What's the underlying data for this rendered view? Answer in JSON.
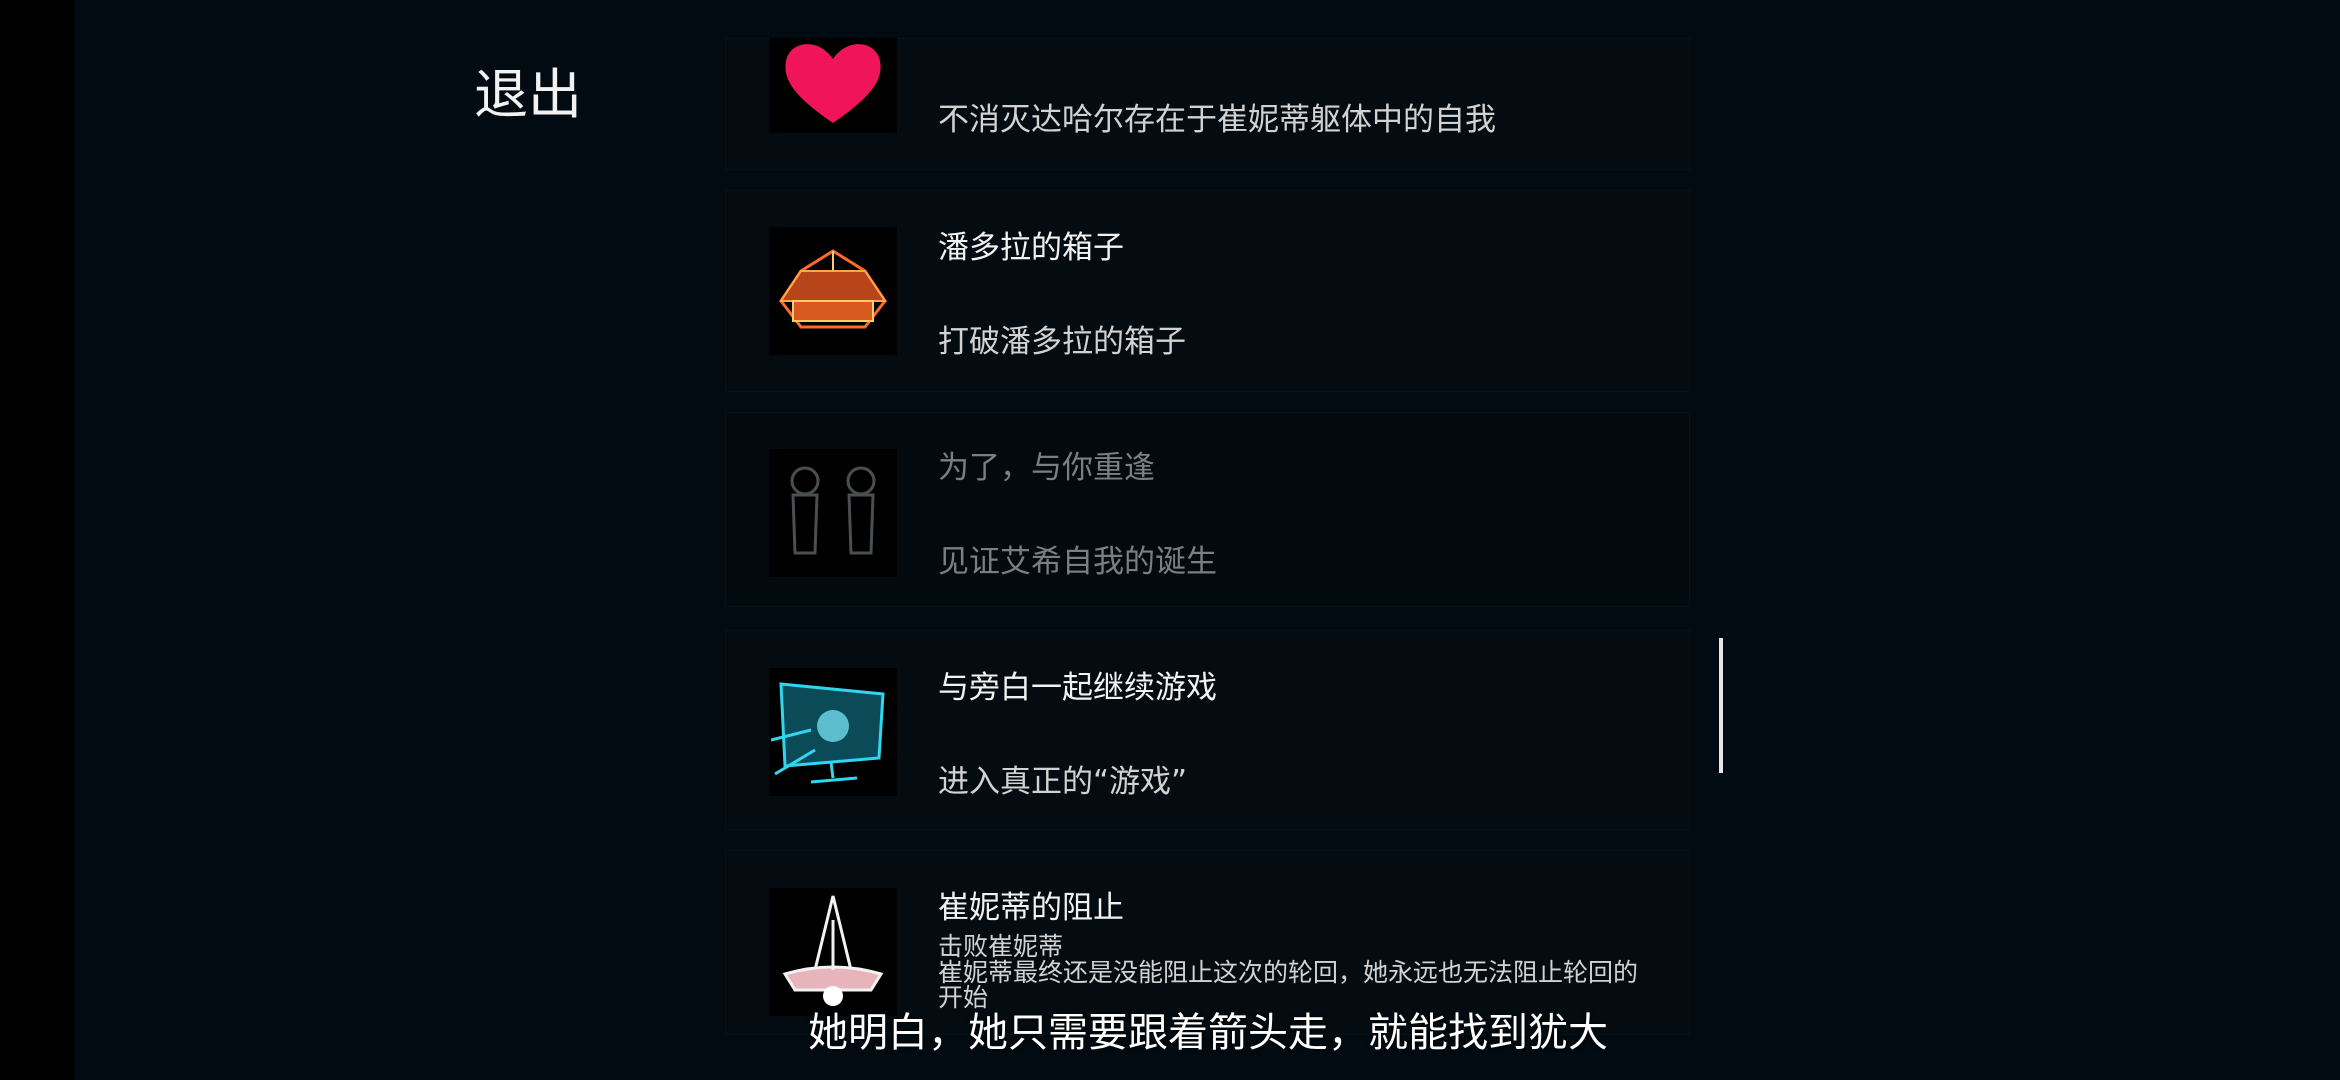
{
  "menu": {
    "exit_label": "退出"
  },
  "achievements": [
    {
      "title": "",
      "description": "不消灭达哈尔存在于崔妮蒂躯体中的自我",
      "icon": "heart-icon",
      "locked": false
    },
    {
      "title": "潘多拉的箱子",
      "description": "打破潘多拉的箱子",
      "icon": "pandora-box-icon",
      "locked": false
    },
    {
      "title": "为了，与你重逢",
      "description": "见证艾希自我的诞生",
      "icon": "twin-figures-icon",
      "locked": true
    },
    {
      "title": "与旁白一起继续游戏",
      "description": "进入真正的“游戏”",
      "icon": "monitor-icon",
      "locked": false
    },
    {
      "title": "崔妮蒂的阻止",
      "description": "击败崔妮蒂",
      "extra": "崔妮蒂最终还是没能阻止这次的轮回，她永远也无法阻止轮回的开始",
      "icon": "spire-icon",
      "locked": false
    }
  ],
  "subtitle": "她明白，她只需要跟着箭头走，就能找到犹大",
  "colors": {
    "background": "#020b12",
    "card": "#040c11",
    "heart": "#f0155a",
    "box": "#ff6a2a",
    "cyan": "#2fd6ef"
  }
}
